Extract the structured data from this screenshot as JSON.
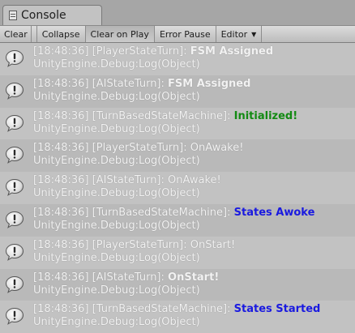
{
  "tab": {
    "title": "Console",
    "icon": "console-icon"
  },
  "toolbar": {
    "clear": "Clear",
    "collapse": "Collapse",
    "clear_on_play": "Clear on Play",
    "error_pause": "Error Pause",
    "editor": "Editor"
  },
  "logs": [
    {
      "prefix": "[18:48:36] [PlayerStateTurn]: ",
      "message": "FSM Assigned",
      "style": "bold-white",
      "trace": "UnityEngine.Debug:Log(Object)"
    },
    {
      "prefix": "[18:48:36] [AIStateTurn]: ",
      "message": "FSM Assigned",
      "style": "bold-white",
      "trace": "UnityEngine.Debug:Log(Object)"
    },
    {
      "prefix": "[18:48:36] [TurnBasedStateMachine]: ",
      "message": "Initialized!",
      "style": "green",
      "trace": "UnityEngine.Debug:Log(Object)"
    },
    {
      "prefix": "[18:48:36] [PlayerStateTurn]: ",
      "message": "OnAwake!",
      "style": "plain",
      "trace": "UnityEngine.Debug:Log(Object)"
    },
    {
      "prefix": "[18:48:36] [AIStateTurn]: ",
      "message": "OnAwake!",
      "style": "plain",
      "trace": "UnityEngine.Debug:Log(Object)"
    },
    {
      "prefix": "[18:48:36] [TurnBasedStateMachine]: ",
      "message": "States Awoke",
      "style": "blue",
      "trace": "UnityEngine.Debug:Log(Object)"
    },
    {
      "prefix": "[18:48:36] [PlayerStateTurn]: ",
      "message": "OnStart!",
      "style": "plain",
      "trace": "UnityEngine.Debug:Log(Object)"
    },
    {
      "prefix": "[18:48:36] [AIStateTurn]: ",
      "message": "OnStart!",
      "style": "bold-white",
      "trace": "UnityEngine.Debug:Log(Object)"
    },
    {
      "prefix": "[18:48:36] [TurnBasedStateMachine]: ",
      "message": "States Started",
      "style": "blue",
      "trace": "UnityEngine.Debug:Log(Object)"
    }
  ],
  "log_icon": "info-bubble-icon",
  "colors": {
    "green": "#138a13",
    "blue": "#1a1ae0",
    "text": "#f2f2f2"
  }
}
